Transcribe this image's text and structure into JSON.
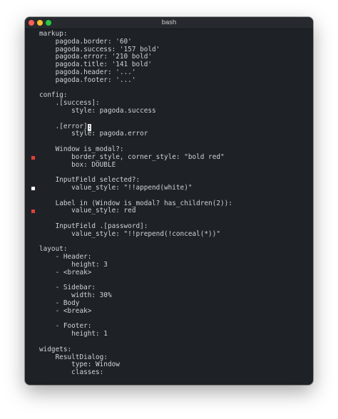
{
  "window": {
    "title": "bash",
    "traffic_lights": {
      "close": "#ff5f57",
      "minimize": "#febc2e",
      "maximize": "#28c840"
    }
  },
  "editor": {
    "text_color": "#cfd3d6",
    "lines": [
      "markup:",
      "    pagoda.border: '60'",
      "    pagoda.success: '157 bold'",
      "    pagoda.error: '210 bold'",
      "    pagoda.title: '141 bold'",
      "    pagoda.header: '...'",
      "    pagoda.footer: '...'",
      "",
      "config:",
      "    .[success]:",
      "        style: pagoda.success",
      "",
      "    .[error]",
      "        style: pagoda.error",
      "",
      "    Window is_modal?:",
      "        border_style, corner_style: \"bold red\"",
      "        box: DOUBLE",
      "",
      "    InputField selected?:",
      "        value_style: \"!!append(white)\"",
      "",
      "    Label in (Window is_modal? has_children(2)):",
      "        value_style: red",
      "",
      "    InputField .[password]:",
      "        value_style: \"!!prepend(!conceal(*))\"",
      "",
      "layout:",
      "    - Header:",
      "        height: 3",
      "    - <break>",
      "",
      "    - Sidebar:",
      "        width: 30%",
      "    - Body",
      "    - <break>",
      "",
      "    - Footer:",
      "        height: 1",
      "",
      "widgets:",
      "    ResultDialog:",
      "        type: Window",
      "        classes:"
    ],
    "cursor": {
      "line": 12,
      "char": ":"
    },
    "gutter_marks": [
      {
        "line": 16,
        "color": "#e0403a"
      },
      {
        "line": 20,
        "color": "#ffffff"
      },
      {
        "line": 23,
        "color": "#e0403a"
      }
    ]
  }
}
